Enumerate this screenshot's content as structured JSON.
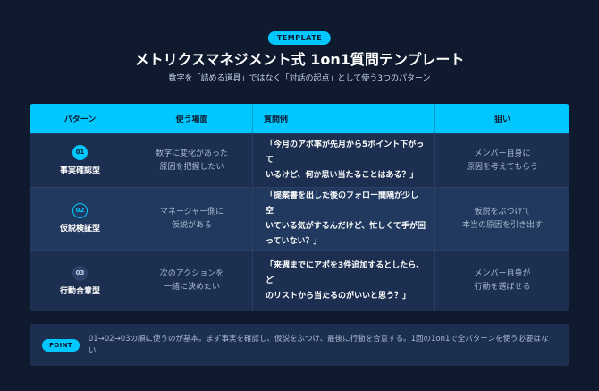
{
  "header": {
    "badge": "TEMPLATE",
    "title": "メトリクスマネジメント式 1on1質問テンプレート",
    "subtitle": "数字を「詰める道具」ではなく「対話の起点」として使う3つのパターン"
  },
  "table": {
    "headers": [
      "パターン",
      "使う場面",
      "質問例",
      "狙い"
    ],
    "rows": [
      {
        "number": "01",
        "name": "事実確認型",
        "scene": [
          "数字に変化があった",
          "原因を把握したい"
        ],
        "question": [
          "「今月のアポ率が先月から5ポイント下がって",
          "いるけど、何か思い当たることはある？」"
        ],
        "aim": [
          "メンバー自身に",
          "原因を考えてもらう"
        ]
      },
      {
        "number": "02",
        "name": "仮説検証型",
        "scene": [
          "マネージャー側に",
          "仮説がある"
        ],
        "question": [
          "「提案書を出した後のフォロー間隔が少し空",
          "いている気がするんだけど、忙しくて手が回",
          "っていない？」"
        ],
        "aim": [
          "仮説をぶつけて",
          "本当の原因を引き出す"
        ]
      },
      {
        "number": "03",
        "name": "行動合意型",
        "scene": [
          "次のアクションを",
          "一緒に決めたい"
        ],
        "question": [
          "「来週までにアポを3件追加するとしたら、ど",
          "のリストから当たるのがいいと思う？」"
        ],
        "aim": [
          "メンバー自身が",
          "行動を選ばせる"
        ]
      }
    ]
  },
  "point": {
    "badge": "POINT",
    "text": [
      "01→02→03の順に使うのが基本。まず事実を確認し、仮説をぶつけ、最後に行動を合意する。1回の1on1で全パターンを使う必要はな",
      "い"
    ]
  },
  "colors": {
    "background": "#0f1a2e",
    "accent": "#00c8ff",
    "panel": "#1c2f50"
  }
}
